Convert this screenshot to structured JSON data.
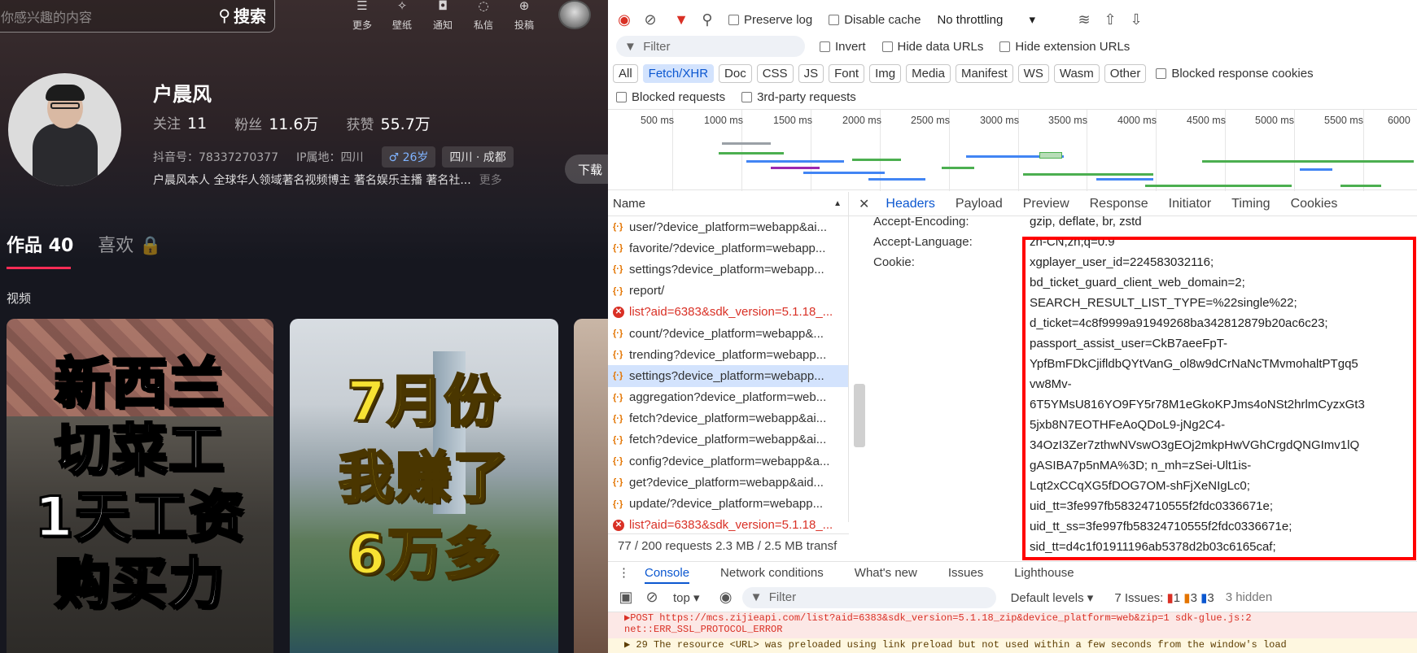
{
  "left": {
    "search_placeholder": "你感兴趣的内容",
    "search_button": "搜索",
    "top_icons": [
      {
        "label": "更多",
        "icon": "menu-icon"
      },
      {
        "label": "壁纸",
        "icon": "wallpaper-icon"
      },
      {
        "label": "通知",
        "icon": "bell-icon"
      },
      {
        "label": "私信",
        "icon": "message-icon"
      },
      {
        "label": "投稿",
        "icon": "upload-icon"
      }
    ],
    "profile": {
      "name": "户晨风",
      "follow_label": "关注",
      "follow_value": "11",
      "fans_label": "粉丝",
      "fans_value": "11.6万",
      "likes_label": "获赞",
      "likes_value": "55.7万",
      "douyin_id": "抖音号：78337270377",
      "ip": "IP属地：四川",
      "age_tag": "♂ 26岁",
      "location_tag": "四川 · 成都",
      "bio": "户晨风本人 全球华人领域著名视频博主 著名娱乐主播 著名社...",
      "bio_more": "更多",
      "download": "下载"
    },
    "tabs": {
      "works": "作品 40",
      "likes": "喜欢"
    },
    "section": "视频",
    "cards": [
      {
        "lines": [
          "新西兰",
          "切菜工",
          "1天工资",
          "购买力"
        ]
      },
      {
        "lines": [
          "7月份",
          "我赚了",
          "6万多"
        ]
      }
    ]
  },
  "devtools": {
    "toolbar": {
      "preserve_log": "Preserve log",
      "disable_cache": "Disable cache",
      "throttling": "No throttling"
    },
    "filter": {
      "placeholder": "Filter",
      "invert": "Invert",
      "hide_data": "Hide data URLs",
      "hide_ext": "Hide extension URLs"
    },
    "types": [
      "All",
      "Fetch/XHR",
      "Doc",
      "CSS",
      "JS",
      "Font",
      "Img",
      "Media",
      "Manifest",
      "WS",
      "Wasm",
      "Other"
    ],
    "blocked_cookies": "Blocked response cookies",
    "blocked_requests": "Blocked requests",
    "third_party": "3rd-party requests",
    "ticks": [
      "500 ms",
      "1000 ms",
      "1500 ms",
      "2000 ms",
      "2500 ms",
      "3000 ms",
      "3500 ms",
      "4000 ms",
      "4500 ms",
      "5000 ms",
      "5500 ms",
      "6000"
    ],
    "name_header": "Name",
    "requests": [
      {
        "name": "user/?device_platform=webapp&ai...",
        "error": false
      },
      {
        "name": "favorite/?device_platform=webapp...",
        "error": false
      },
      {
        "name": "settings?device_platform=webapp...",
        "error": false
      },
      {
        "name": "report/",
        "error": false
      },
      {
        "name": "list?aid=6383&sdk_version=5.1.18_...",
        "error": true
      },
      {
        "name": "count/?device_platform=webapp&...",
        "error": false
      },
      {
        "name": "trending?device_platform=webapp...",
        "error": false
      },
      {
        "name": "settings?device_platform=webapp...",
        "error": false,
        "selected": true
      },
      {
        "name": "aggregation?device_platform=web...",
        "error": false
      },
      {
        "name": "fetch?device_platform=webapp&ai...",
        "error": false
      },
      {
        "name": "fetch?device_platform=webapp&ai...",
        "error": false
      },
      {
        "name": "config?device_platform=webapp&a...",
        "error": false
      },
      {
        "name": "get?device_platform=webapp&aid...",
        "error": false
      },
      {
        "name": "update/?device_platform=webapp...",
        "error": false
      },
      {
        "name": "list?aid=6383&sdk_version=5.1.18_...",
        "error": true
      }
    ],
    "status": "77 / 200 requests    2.3 MB / 2.5 MB transf",
    "detail_tabs": [
      "Headers",
      "Payload",
      "Preview",
      "Response",
      "Initiator",
      "Timing",
      "Cookies"
    ],
    "headers": [
      {
        "key": "Accept-Encoding:",
        "value": "gzip, deflate, br, zstd"
      },
      {
        "key": "Accept-Language:",
        "value": "zh-CN,zh;q=0.9"
      },
      {
        "key": "Cookie:",
        "value": "xgplayer_user_id=224583032116;"
      }
    ],
    "cookie_lines": [
      "bd_ticket_guard_client_web_domain=2;",
      "SEARCH_RESULT_LIST_TYPE=%22single%22;",
      "d_ticket=4c8f9999a91949268ba342812879b20ac6c23;",
      "passport_assist_user=CkB7aeeFpT-",
      "YpfBmFDkCjifldbQYtVanG_ol8w9dCrNaNcTMvmohaltPTgq5",
      "vw8Mv-",
      "6T5YMsU816YO9FY5r78M1eGkoKPJms4oNSt2hrlmCyzxGt3",
      "5jxb8N7EOTHFeAoQDoL9-jNg2C4-",
      "34OzI3Zer7zthwNVswO3gEOj2mkpHwVGhCrgdQNGImv1lQ",
      "gASIBA7p5nMA%3D; n_mh=zSei-Ult1is-",
      "Lqt2xCCqXG5fDOG7OM-shFjXeNIgLc0;",
      "uid_tt=3fe997fb58324710555f2fdc0336671e;",
      "uid_tt_ss=3fe997fb58324710555f2fdc0336671e;",
      "sid_tt=d4c1f01911196ab5378d2b03c6165caf;"
    ],
    "console_tabs": [
      "Console",
      "Network conditions",
      "What's new",
      "Issues",
      "Lighthouse"
    ],
    "console_toolbar": {
      "context": "top ▾",
      "filter": "Filter",
      "levels": "Default levels ▾",
      "issues": "7 Issues:",
      "i1": "1",
      "i2": "3",
      "i3": "3",
      "hidden": "3 hidden"
    },
    "console_msg": "▶POST https://mcs.zijieapi.com/list?aid=6383&sdk_version=5.1.18_zip&device_platform=web&zip=1     sdk-glue.js:2",
    "console_msg2": "net::ERR_SSL_PROTOCOL_ERROR",
    "console_msg3": "▶ 29  The resource <URL> was preloaded using link preload but not used within a few seconds from the window's load"
  }
}
